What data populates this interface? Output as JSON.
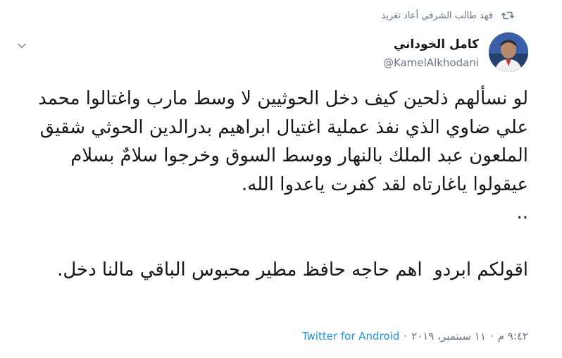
{
  "retweet": {
    "text": "فهد طالب الشرفي أعاد تغريد",
    "icon": "retweet-icon"
  },
  "author": {
    "name": "كامل الخوداني",
    "handle": "@KamelAlkhodani",
    "avatar": "avatar"
  },
  "menu": {
    "icon": "chevron-down-icon"
  },
  "tweet": {
    "text": "لو نسألهم ذلحين كيف دخل الحوثيين لا وسط مارب واغتالوا محمد علي ضاوي الذي نفذ عملية اغتيال ابراهيم بدرالدين الحوثي شقيق الملعون عبد الملك بالنهار ووسط السوق وخرجوا سلامٌ بسلام عيقولوا ياغارتاه لقد كفرت ياعدوا الله.\n..\n\nاقولكم ابردو  اهم حاجه حافظ مطير محبوس الباقي مالنا دخل."
  },
  "meta": {
    "time": "٩:٤٢ م",
    "date": "١١ سبتمبر، ٢٠١٩",
    "separator": "·",
    "source": "Twitter for Android"
  },
  "colors": {
    "text": "#14171a",
    "secondary": "#657786",
    "link": "#1b95e0"
  }
}
